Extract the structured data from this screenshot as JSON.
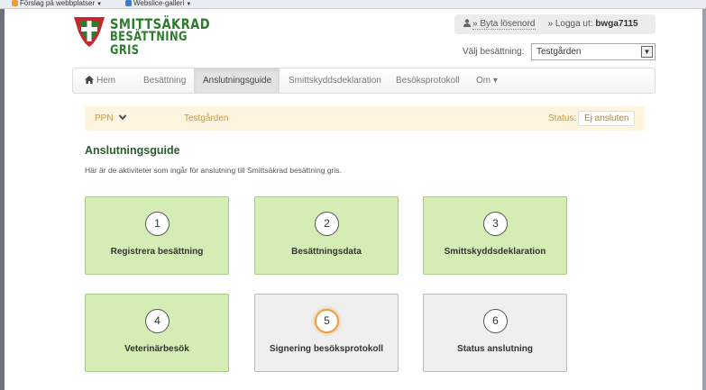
{
  "browser": {
    "favorites": [
      {
        "label": "Förslag på webbplatser",
        "color": "#e8a030"
      },
      {
        "label": "Webslice-galleri",
        "color": "#3b7bd0"
      }
    ]
  },
  "header": {
    "logo_line1": "SMITTSÄKRAD",
    "logo_line2": "BESÄTTNING GRIS",
    "change_password": "» Byta lösenord",
    "logout_prefix": "» Logga ut: ",
    "username": "bwga7115",
    "herd_label": "Välj besättning:",
    "herd_selected": "Testgården"
  },
  "nav": {
    "items": [
      {
        "label": "Hem"
      },
      {
        "label": "Besättning"
      },
      {
        "label": "Anslutningsguide"
      },
      {
        "label": "Smittskyddsdeklaration"
      },
      {
        "label": "Besöksprotokoll"
      },
      {
        "label": "Om"
      }
    ],
    "active": "Anslutningsguide",
    "om_caret": "▾"
  },
  "status_strip": {
    "ppn": "PPN",
    "herd": "Testgården",
    "status_label": "Status:",
    "status_value": "Ej ansluten"
  },
  "main": {
    "title": "Anslutningsguide",
    "description": "Här är de aktiviteter som ingår för anslutning till Smittsäkrad besättning gris."
  },
  "steps": [
    {
      "number": "1",
      "label": "Registrera besättning",
      "state": "done"
    },
    {
      "number": "2",
      "label": "Besättningsdata",
      "state": "done"
    },
    {
      "number": "3",
      "label": "Smittskyddsdeklaration",
      "state": "done"
    },
    {
      "number": "4",
      "label": "Veterinärbesök",
      "state": "done"
    },
    {
      "number": "5",
      "label": "Signering besöksprotokoll",
      "state": "current"
    },
    {
      "number": "6",
      "label": "Status anslutning",
      "state": "todo"
    }
  ],
  "colors": {
    "brand_green": "#2b7d2b",
    "brand_red": "#c8252c",
    "step_done": "#d3edb5",
    "step_todo": "#efefef",
    "step_current_ring": "#e8a040"
  }
}
